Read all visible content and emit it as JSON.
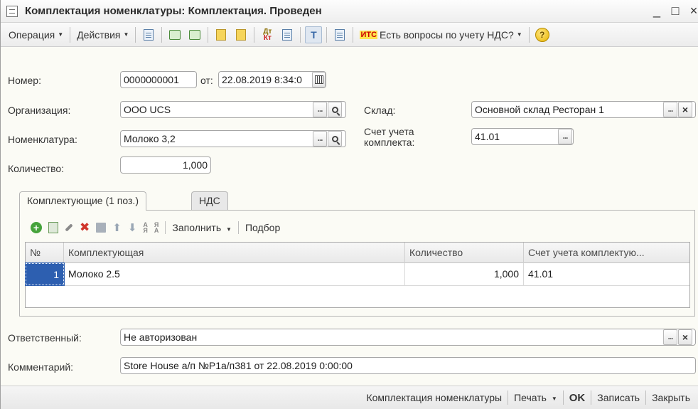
{
  "window": {
    "title": "Комплектация номенклатуры: Комплектация. Проведен",
    "minimize": "_",
    "maximize": "□",
    "close": "×"
  },
  "toolbar": {
    "operation_label": "Операция",
    "actions_label": "Действия",
    "its_badge": "ИТС",
    "vat_question_label": "Есть вопросы по учету НДС?",
    "dt_label": "Дт",
    "kt_label": "Кт",
    "help_label": "?",
    "dropdown_arrow": "▼"
  },
  "form": {
    "number_label": "Номер:",
    "number_value": "0000000001",
    "date_label": "от:",
    "date_value": "22.08.2019  8:34:0",
    "organization_label": "Организация:",
    "organization_value": "ООО UCS",
    "warehouse_label": "Склад:",
    "warehouse_value": "Основной склад Ресторан 1",
    "nomenclature_label": "Номенклатура:",
    "nomenclature_value": "Молоко 3,2",
    "account_label_line1": "Счет учета",
    "account_label_line2": "комплекта:",
    "account_value": "41.01",
    "quantity_label": "Количество:",
    "quantity_value": "1,000",
    "dots": "...",
    "clear": "×"
  },
  "tabs": [
    {
      "label": "Комплектующие (1 поз.)",
      "active": true
    },
    {
      "label": "НДС",
      "active": false
    }
  ],
  "components_toolbar": {
    "plus": "+",
    "delete": "✖",
    "up": "⬆",
    "down": "⬇",
    "fill_label": "Заполнить",
    "selection_label": "Подбор",
    "sort_asc_top": "А",
    "sort_asc_bottom": "Я",
    "sort_desc_top": "Я",
    "sort_desc_bottom": "А"
  },
  "table": {
    "columns": [
      "№",
      "Комплектующая",
      "Количество",
      "Счет учета комплектую..."
    ],
    "rows": [
      {
        "num": "1",
        "component": "Молоко 2.5",
        "quantity": "1,000",
        "account": "41.01"
      }
    ]
  },
  "responsible": {
    "label": "Ответственный:",
    "value": "Не авторизован"
  },
  "comment": {
    "label": "Комментарий:",
    "value": "Store House а/п №Р1а/п381 от 22.08.2019 0:00:00"
  },
  "footer": {
    "nomenclature_kit_label": "Комплектация номенклатуры",
    "print_label": "Печать",
    "ok_label": "OK",
    "save_label": "Записать",
    "close_label": "Закрыть"
  },
  "colors": {
    "selected_cell": "#2d5fb0",
    "delete_icon": "#d0352b",
    "add_icon": "#46a33c",
    "its_badge": "#c00000"
  }
}
